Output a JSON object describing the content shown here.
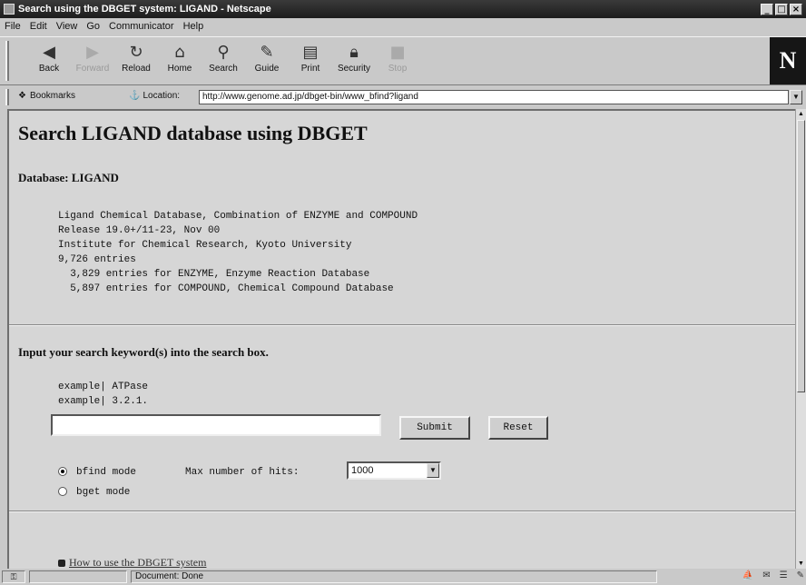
{
  "window": {
    "title": "Search using the DBGET system: LIGAND - Netscape"
  },
  "menu": [
    "File",
    "Edit",
    "View",
    "Go",
    "Communicator",
    "Help"
  ],
  "toolbar": {
    "buttons": [
      {
        "label": "Back",
        "icon": "back-arrow-icon"
      },
      {
        "label": "Forward",
        "icon": "forward-arrow-icon",
        "disabled": true
      },
      {
        "label": "Reload",
        "icon": "reload-icon"
      },
      {
        "label": "Home",
        "icon": "home-icon"
      },
      {
        "label": "Search",
        "icon": "search-icon"
      },
      {
        "label": "Guide",
        "icon": "guide-icon"
      },
      {
        "label": "Print",
        "icon": "print-icon"
      },
      {
        "label": "Security",
        "icon": "security-icon"
      },
      {
        "label": "Stop",
        "icon": "stop-icon",
        "disabled": true
      }
    ],
    "logo": "N"
  },
  "location": {
    "bookmarks_label": "Bookmarks",
    "label": "Location:",
    "url": "http://www.genome.ad.jp/dbget-bin/www_bfind?ligand"
  },
  "page": {
    "title": "Search LIGAND database using DBGET",
    "database_label": "Database: LIGAND",
    "info_lines": [
      "Ligand Chemical Database, Combination of ENZYME and COMPOUND",
      "Release 19.0+/11-23, Nov 00",
      "Institute for Chemical Research, Kyoto University",
      "9,726 entries",
      "  3,829 entries for ENZYME, Enzyme Reaction Database",
      "  5,897 entries for COMPOUND, Chemical Compound Database"
    ],
    "prompt": "Input your search keyword(s) into the search box.",
    "example1": "example|  ATPase",
    "example2": "example|  3.2.1.",
    "search_value": "",
    "submit_label": "Submit",
    "reset_label": "Reset",
    "mode_bfind": "bfind mode",
    "mode_bget": "bget mode",
    "selected_mode": "bfind",
    "max_hits_label": "Max number of hits:",
    "max_hits_value": "1000",
    "howto_link": "How to use the DBGET system"
  },
  "status": {
    "text": "Document: Done"
  }
}
